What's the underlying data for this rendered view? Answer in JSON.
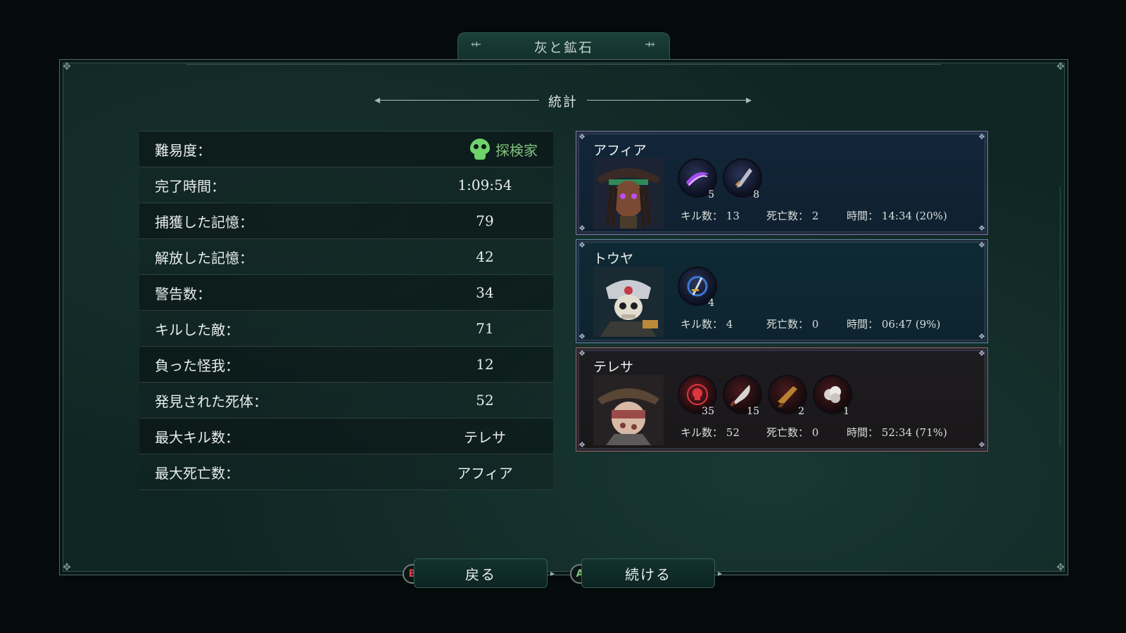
{
  "title": "灰と鉱石",
  "section": "統計",
  "stats": [
    {
      "label": "難易度：",
      "value": "探検家"
    },
    {
      "label": "完了時間：",
      "value": "1:09:54"
    },
    {
      "label": "捕獲した記憶：",
      "value": "79"
    },
    {
      "label": "解放した記憶：",
      "value": "42"
    },
    {
      "label": "警告数：",
      "value": "34"
    },
    {
      "label": "キルした敵：",
      "value": "71"
    },
    {
      "label": "負った怪我：",
      "value": "12"
    },
    {
      "label": "発見された死体：",
      "value": "52"
    },
    {
      "label": "最大キル数：",
      "value": "テレサ"
    },
    {
      "label": "最大死亡数：",
      "value": "アフィア"
    }
  ],
  "difficulty_icon": "green-skull-icon",
  "characters": [
    {
      "name": "アフィア",
      "abilities": [
        {
          "icon": "purple-blade-slash-icon",
          "count": "5"
        },
        {
          "icon": "dagger-icon",
          "count": "8"
        }
      ],
      "kills_label": "キル数：",
      "kills": "13",
      "deaths_label": "死亡数：",
      "deaths": "2",
      "time_label": "時間：",
      "time": "14:34 (20%)"
    },
    {
      "name": "トウヤ",
      "abilities": [
        {
          "icon": "sword-whirl-icon",
          "count": "4"
        }
      ],
      "kills_label": "キル数：",
      "kills": "4",
      "deaths_label": "死亡数：",
      "deaths": "0",
      "time_label": "時間：",
      "time": "06:47 (9%)"
    },
    {
      "name": "テレサ",
      "abilities": [
        {
          "icon": "skull-target-icon",
          "count": "35"
        },
        {
          "icon": "cleaver-icon",
          "count": "15"
        },
        {
          "icon": "pistol-icon",
          "count": "2"
        },
        {
          "icon": "smoke-bomb-icon",
          "count": "1"
        }
      ],
      "kills_label": "キル数：",
      "kills": "52",
      "deaths_label": "死亡数：",
      "deaths": "0",
      "time_label": "時間：",
      "time": "52:34 (71%)"
    }
  ],
  "buttons": {
    "back": {
      "badge": "B",
      "label": "戻る"
    },
    "next": {
      "badge": "A",
      "label": "続ける"
    }
  },
  "colors": {
    "accent_green": "#7fc27a",
    "b_button": "#e0414a",
    "panel_bg": "#0f2523"
  }
}
